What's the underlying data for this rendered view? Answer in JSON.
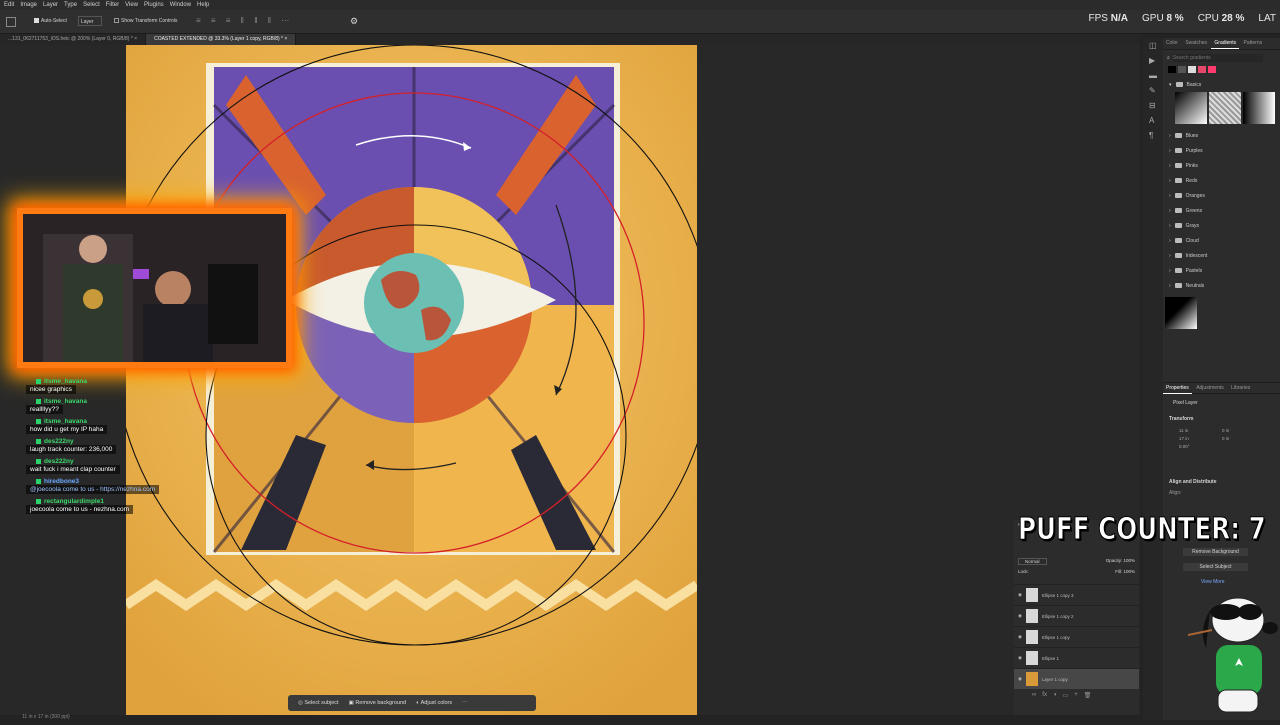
{
  "menu": [
    "Edit",
    "Image",
    "Layer",
    "Type",
    "Select",
    "Filter",
    "View",
    "Plugins",
    "Window",
    "Help"
  ],
  "options_bar": {
    "auto_select": "Auto-Select",
    "layer_dropdown": "Layer",
    "show_transform": "Show Transform Controls"
  },
  "tabs": [
    {
      "label": "...131_062711753_iOS.heic @ 200% (Layer 0, RGB/8) *",
      "active": false
    },
    {
      "label": "COASTED EXTENDED @ 33.3% (Layer 1 copy, RGB/8) *",
      "active": true
    }
  ],
  "stats": {
    "fps_label": "FPS",
    "fps_value": "N/A",
    "gpu_label": "GPU",
    "gpu_value": "8 %",
    "cpu_label": "CPU",
    "cpu_value": "28 %",
    "lat_label": "LAT"
  },
  "right_panel": {
    "tabs": [
      "Color",
      "Swatches",
      "Gradients",
      "Patterns"
    ],
    "active_tab": "Gradients",
    "search_placeholder": "Search gradients",
    "basics_label": "Basics",
    "folders": [
      "Blues",
      "Purples",
      "Pinks",
      "Reds",
      "Oranges",
      "Greens",
      "Grays",
      "Cloud",
      "Iridescent",
      "Pastels",
      "Neutrals"
    ],
    "props_tabs": [
      "Properties",
      "Adjustments",
      "Libraries"
    ],
    "pixel_layer": "Pixel Layer",
    "transform_label": "Transform",
    "align_label": "Align and Distribute",
    "align_sub": "Align:",
    "quick_actions": [
      "Remove Background",
      "Select Subject"
    ],
    "view_more": "View More",
    "transform_fields": {
      "w": "11 in",
      "h": "17 in",
      "x": "0 in",
      "y": "0 in",
      "angle": "0.00°"
    }
  },
  "layers_panel": {
    "blend_mode": "Normal",
    "opacity_label": "Opacity:",
    "opacity_value": "100%",
    "lock_label": "Lock:",
    "fill_label": "Fill:",
    "fill_value": "100%",
    "kind_label": "Kind",
    "layers": [
      "Ellipse 1 copy 3",
      "Ellipse 1 copy 2",
      "Ellipse 1 copy",
      "Ellipse 1",
      "Layer 1 copy"
    ]
  },
  "puff_counter": "PUFF COUNTER: 7",
  "chat": [
    {
      "user": "itsme_havana",
      "message": "nicee graphics",
      "color": "#3cd96b"
    },
    {
      "user": "itsme_havana",
      "message": "reallllyy??",
      "color": "#3cd96b"
    },
    {
      "user": "itsme_havana",
      "message": "how did u get my IP haha",
      "color": "#3cd96b"
    },
    {
      "user": "des222ny",
      "message": "laugh track counter: 236,000",
      "color": "#3cd96b"
    },
    {
      "user": "des222ny",
      "message": "wait fuck i meant clap counter",
      "color": "#3cd96b"
    },
    {
      "user": "hiredbone3",
      "message": "@joecoola come to us - https://nezhna.com",
      "color": "#6aa8ff"
    },
    {
      "user": "rectangulardimple1",
      "message": "joecoola come to us - nezhna.com",
      "color": "#3cd96b"
    }
  ],
  "context_bar": [
    "Select subject",
    "Remove background",
    "Adjust colors"
  ],
  "status_bar": "11 in x 17 in (300 ppi)"
}
